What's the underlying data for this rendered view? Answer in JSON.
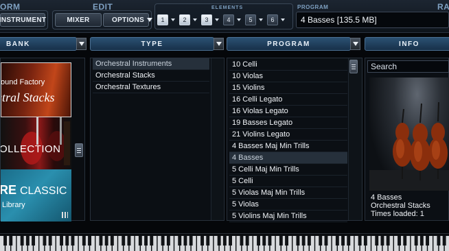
{
  "toolbar": {
    "groups": {
      "form": "ORM",
      "edit": "EDIT",
      "elements": "ELEMENTS",
      "program": "PROGRAM",
      "ra": "RA"
    },
    "instrument_label": "INSTRUMENT",
    "mixer_label": "MIXER",
    "options_label": "OPTIONS",
    "elements": [
      {
        "label": "1",
        "active": true
      },
      {
        "label": "2",
        "active": true
      },
      {
        "label": "3",
        "active": true
      },
      {
        "label": "4",
        "active": false
      },
      {
        "label": "5",
        "active": false
      },
      {
        "label": "6",
        "active": false
      }
    ],
    "program_value": "4 Basses [135.5 MB]"
  },
  "columns": {
    "bank": "BANK",
    "type": "TYPE",
    "program": "PROGRAM",
    "info": "INFO"
  },
  "bank": {
    "tiles": [
      {
        "line1": "ound Factory",
        "line2": "stral Stacks"
      },
      {
        "line1": "OLLECTION"
      },
      {
        "line1": "RE",
        "line1b": "CLASSIC",
        "line2": "Library"
      }
    ]
  },
  "type_list": [
    {
      "label": "Orchestral Instruments",
      "selected": true
    },
    {
      "label": "Orchestral Stacks",
      "selected": false
    },
    {
      "label": "Orchestral Textures",
      "selected": false
    }
  ],
  "program_list": [
    {
      "label": "10 Celli",
      "selected": false
    },
    {
      "label": "10 Violas",
      "selected": false
    },
    {
      "label": "15 Violins",
      "selected": false
    },
    {
      "label": "16 Celli Legato",
      "selected": false
    },
    {
      "label": "16 Violas Legato",
      "selected": false
    },
    {
      "label": "19 Basses Legato",
      "selected": false
    },
    {
      "label": "21 Violins Legato",
      "selected": false
    },
    {
      "label": "4 Basses Maj Min Trills",
      "selected": false
    },
    {
      "label": "4 Basses",
      "selected": true
    },
    {
      "label": "5 Celli Maj Min Trills",
      "selected": false
    },
    {
      "label": "5 Celli",
      "selected": false
    },
    {
      "label": "5 Violas Maj Min Trills",
      "selected": false
    },
    {
      "label": "5 Violas",
      "selected": false
    },
    {
      "label": "5 Violins Maj Min Trills",
      "selected": false
    }
  ],
  "info": {
    "search_placeholder": "Search",
    "name": "4 Basses",
    "category": "Orchestral Stacks",
    "times_loaded": "Times loaded: 1"
  },
  "colors": {
    "header_blue": "#2b5173",
    "panel_bg": "#0b0f14",
    "selected_row": "#26303b",
    "active_element": "#e8edf2"
  }
}
